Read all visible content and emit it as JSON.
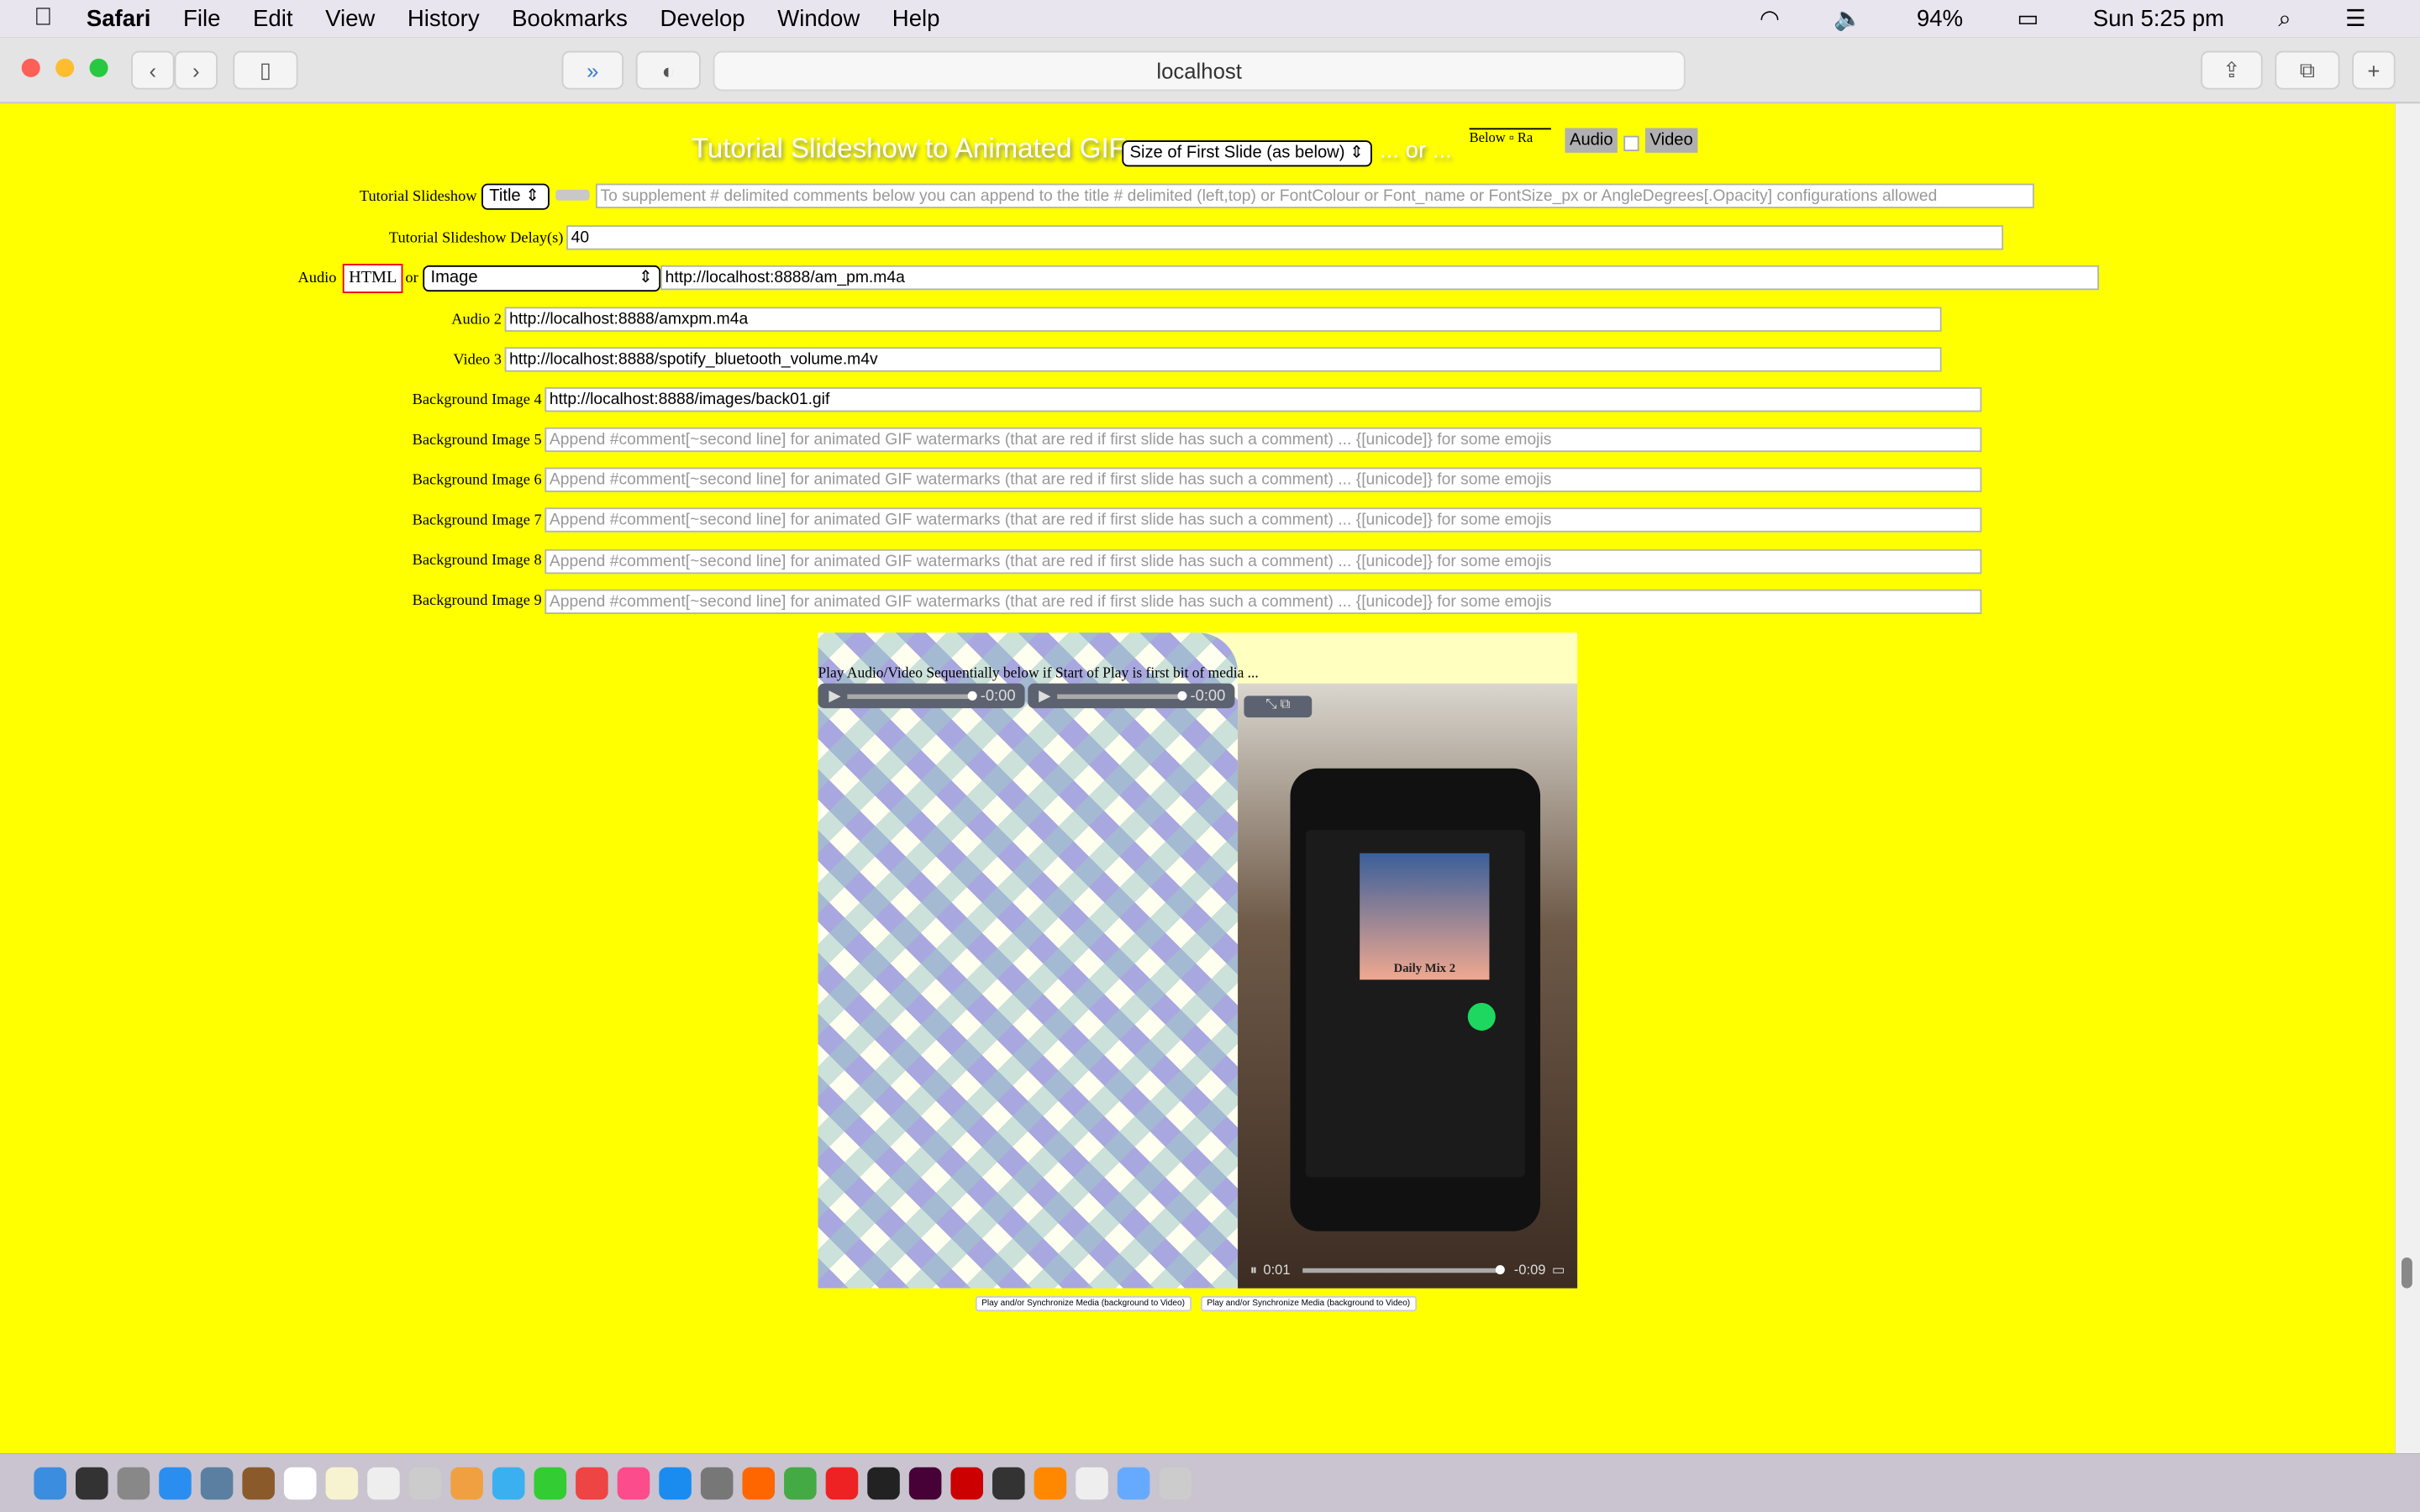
{
  "menubar": {
    "apple": "",
    "app": "Safari",
    "items": [
      "File",
      "Edit",
      "View",
      "History",
      "Bookmarks",
      "Develop",
      "Window",
      "Help"
    ],
    "battery": "94%",
    "clock": "Sun 5:25 pm"
  },
  "toolbar": {
    "url": "localhost"
  },
  "page": {
    "title": "Tutorial Slideshow to Animated GIF",
    "size_select": "Size of First Slide (as below)",
    "or_text": "... or ...",
    "below_label": "Below",
    "ra_label": "Ra",
    "audio_btn": "Audio",
    "video_btn": "Video",
    "rows": [
      {
        "label": "Tutorial Slideshow",
        "select": "Title",
        "value": "",
        "placeholder": "To supplement # delimited comments below you can append to the title # delimited (left,top) or FontColour or Font_name or FontSize_px or AngleDegrees[.Opacity] configurations allowed"
      },
      {
        "label": "Tutorial Slideshow Delay(s)",
        "value": "40"
      },
      {
        "label": "Audio",
        "html_btn": "HTML",
        "or": "or",
        "select": "Image",
        "value": "http://localhost:8888/am_pm.m4a"
      },
      {
        "label": "Audio 2",
        "value": "http://localhost:8888/amxpm.m4a"
      },
      {
        "label": "Video 3",
        "value": "http://localhost:8888/spotify_bluetooth_volume.m4v"
      },
      {
        "label": "Background Image 4",
        "value": "http://localhost:8888/images/back01.gif"
      },
      {
        "label": "Background Image 5",
        "placeholder": "Append #comment[~second line] for animated GIF watermarks (that are red if first slide has such a comment) ... {[unicode]} for some emojis"
      },
      {
        "label": "Background Image 6",
        "placeholder": "Append #comment[~second line] for animated GIF watermarks (that are red if first slide has such a comment) ... {[unicode]} for some emojis"
      },
      {
        "label": "Background Image 7",
        "placeholder": "Append #comment[~second line] for animated GIF watermarks (that are red if first slide has such a comment) ... {[unicode]} for some emojis"
      },
      {
        "label": "Background Image 8",
        "placeholder": "Append #comment[~second line] for animated GIF watermarks (that are red if first slide has such a comment) ... {[unicode]} for some emojis"
      },
      {
        "label": "Background Image 9",
        "placeholder": "Append #comment[~second line] for animated GIF watermarks (that are red if first slide has such a comment) ... {[unicode]} for some emojis"
      }
    ],
    "media": {
      "text": "Play Audio/Video Sequentially below if Start of Play is first bit of media ...",
      "audio1_time": "-0:00",
      "audio2_time": "-0:00",
      "video_time_start": "0:01",
      "video_time_end": "-0:09",
      "phone_playlist": "Daily Mix 2"
    },
    "play_btn_1": "Play and/or Synchronize Media (background to Video)",
    "play_btn_2": "Play and/or Synchronize Media (background to Video)"
  },
  "colors": {
    "page_bg": "#ffff00",
    "title": "#ffffff"
  }
}
